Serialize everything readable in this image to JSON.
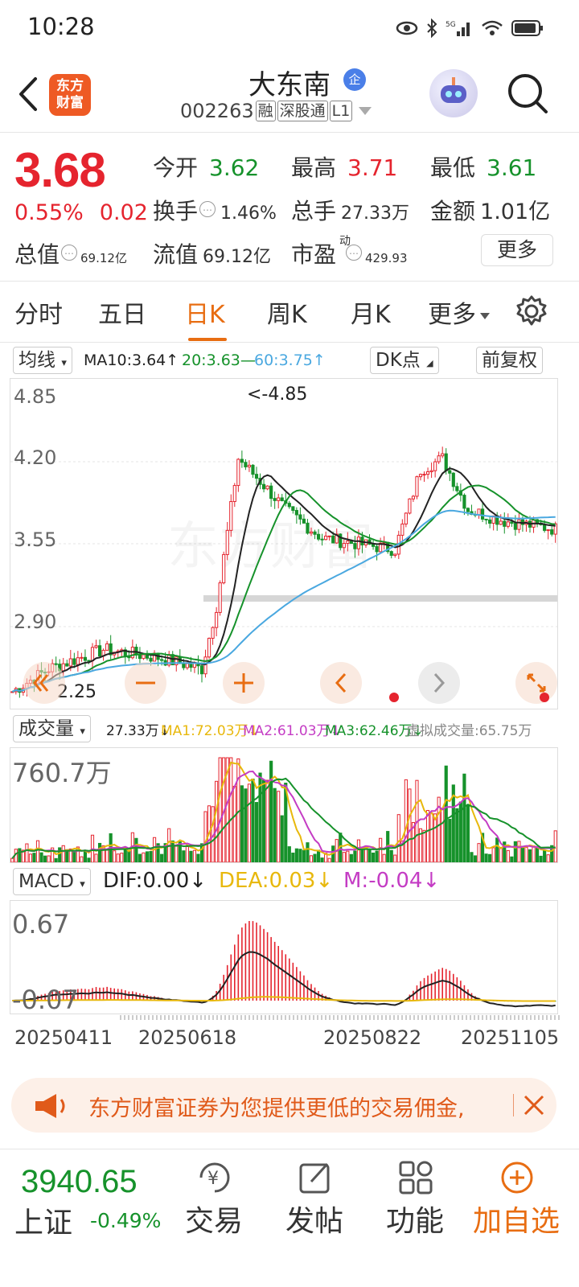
{
  "status": {
    "time": "10:28",
    "signal_label": "5G"
  },
  "header": {
    "logo_text_1": "东方",
    "logo_text_2": "财富",
    "stock_name": "大东南",
    "badge": "企",
    "stock_code": "002263",
    "tags": [
      "融",
      "深股通",
      "L1"
    ]
  },
  "quote": {
    "price": "3.68",
    "change_pct": "0.55%",
    "change_abs": "0.02",
    "open_label": "今开",
    "open": "3.62",
    "high_label": "最高",
    "high": "3.71",
    "low_label": "最低",
    "low": "3.61",
    "turnover_label": "换手",
    "turnover": "1.46%",
    "volume_label": "总手",
    "volume": "27.33万",
    "amount_label": "金额",
    "amount": "1.01亿",
    "total_value_label": "总值",
    "total_value": "69.12亿",
    "float_value_label": "流值",
    "float_value": "69.12亿",
    "pe_label": "市盈",
    "pe_sup": "动",
    "pe": "429.93",
    "more": "更多"
  },
  "tabs": [
    "分时",
    "五日",
    "日K",
    "周K",
    "月K",
    "更多"
  ],
  "active_tab": "日K",
  "ma_bar": {
    "selector": "均线",
    "ma10": "MA10:3.64",
    "ma20": "20:3.63",
    "ma60": "60:3.75",
    "dk": "DK点",
    "adjust": "前复权"
  },
  "kline": {
    "y_labels": [
      "4.85",
      "4.20",
      "3.55",
      "2.90"
    ],
    "max_marker": "<-4.85",
    "min_marker": "2.25",
    "watermark": "东方财富",
    "controls": [
      "collapse-left",
      "minus",
      "plus",
      "prev",
      "next",
      "fullscreen"
    ]
  },
  "volume_bar": {
    "selector": "成交量",
    "current": "27.33万",
    "ma1": "MA1:72.03万",
    "ma2": "MA2:61.03万",
    "ma3": "MA3:62.46万",
    "virtual": "虚拟成交量:65.75万",
    "y_label": "760.7万"
  },
  "macd_bar": {
    "selector": "MACD",
    "dif": "DIF:0.00",
    "dea": "DEA:0.03",
    "m": "M:-0.04",
    "y_top": "0.67",
    "y_bottom": "-0.07"
  },
  "dates": [
    "20250411",
    "20250618",
    "20250822",
    "20251105"
  ],
  "promo": {
    "text": "东方财富证券为您提供更低的交易佣金,"
  },
  "bottom": {
    "index_value": "3940.65",
    "index_name": "上证",
    "index_change": "-0.49%",
    "nav": [
      "交易",
      "发帖",
      "功能",
      "加自选"
    ],
    "trade_icon_glyph": "¥"
  },
  "colors": {
    "up": "#e5242e",
    "down": "#16922b",
    "accent": "#e86d12",
    "ma10": "#222222",
    "ma20": "#16922b",
    "ma60": "#4aa8e0"
  }
}
